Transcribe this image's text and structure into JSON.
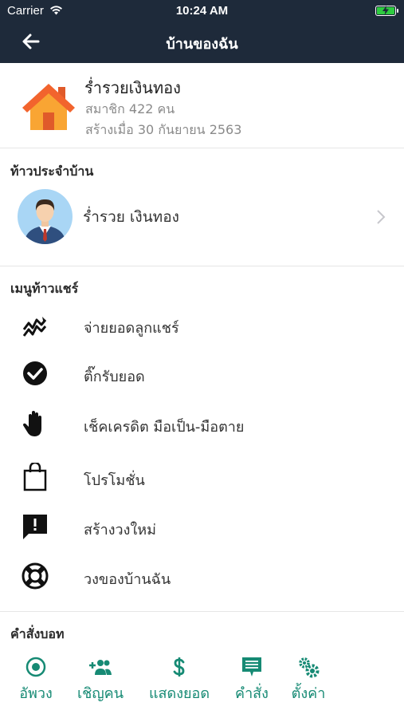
{
  "status_bar": {
    "carrier": "Carrier",
    "time": "10:24 AM",
    "battery_color": "#2ecc40"
  },
  "nav": {
    "back_icon": "arrow-left-icon",
    "title": "บ้านของฉัน"
  },
  "house": {
    "icon": "house-icon",
    "name": "ร่ำรวยเงินทอง",
    "members": "สมาชิก 422 คน",
    "created": "สร้างเมื่อ 30 กันยายน 2563"
  },
  "owner_section": {
    "title": "ท้าวประจำบ้าน",
    "name": "ร่ำรวย เงินทอง",
    "avatar_icon": "user-avatar-icon",
    "chevron_icon": "chevron-right-icon"
  },
  "menu_section": {
    "title": "เมนูท้าวแชร์",
    "items": [
      {
        "icon": "chart-down-icon",
        "label": "จ่ายยอดลูกแชร์"
      },
      {
        "icon": "check-circle-icon",
        "label": "ติ๊กรับยอด"
      },
      {
        "icon": "hand-icon",
        "label": "เช็คเครดิต มือเป็น-มือตาย"
      },
      {
        "icon": "shopping-bag-icon",
        "label": "โปรโมชั่น"
      },
      {
        "icon": "alert-message-icon",
        "label": "สร้างวงใหม่"
      },
      {
        "icon": "lifebuoy-icon",
        "label": "วงของบ้านฉัน"
      }
    ]
  },
  "commands_section": {
    "title": "คำสั่งบอท",
    "accent": "#168a74",
    "items": [
      {
        "icon": "record-icon",
        "label": "อัพวง"
      },
      {
        "icon": "add-group-icon",
        "label": "เชิญคน"
      },
      {
        "icon": "dollar-icon",
        "label": "แสดงยอด"
      },
      {
        "icon": "message-list-icon",
        "label": "คำสั่ง"
      },
      {
        "icon": "gears-icon",
        "label": "ตั้งค่า"
      }
    ]
  }
}
